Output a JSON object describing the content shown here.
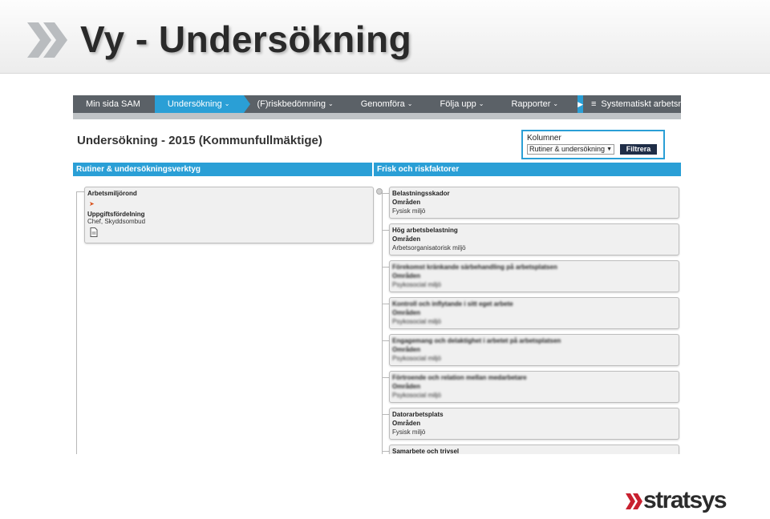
{
  "slide": {
    "title": "Vy - Undersökning",
    "logo_text": "stratsys"
  },
  "nav": {
    "items": [
      {
        "label": "Min sida SAM",
        "dropdown": false,
        "active": false
      },
      {
        "label": "Undersökning",
        "dropdown": true,
        "active": true
      },
      {
        "label": "(F)riskbedömning",
        "dropdown": true,
        "active": false
      },
      {
        "label": "Genomföra",
        "dropdown": true,
        "active": false
      },
      {
        "label": "Följa upp",
        "dropdown": true,
        "active": false
      },
      {
        "label": "Rapporter",
        "dropdown": true,
        "active": false
      }
    ],
    "last_label": "Systematiskt arbetsmiljöar..."
  },
  "page": {
    "title": "Undersökning - 2015 (Kommunfullmäktige)"
  },
  "columns_box": {
    "label": "Kolumner",
    "selected": "Rutiner & undersökning",
    "filter_button": "Filtrera"
  },
  "headers": {
    "left": "Rutiner & undersökningsverktyg",
    "right": "Frisk och riskfaktorer"
  },
  "left_card": {
    "title": "Arbetsmiljörond",
    "subtitle": "Uppgiftsfördelning",
    "roles": "Chef, Skyddsombud"
  },
  "right_cards": [
    {
      "title": "Belastningsskador",
      "area_label": "Områden",
      "area": "Fysisk miljö",
      "blurred": false
    },
    {
      "title": "Hög arbetsbelastning",
      "area_label": "Områden",
      "area": "Arbetsorganisatorisk miljö",
      "blurred": false
    },
    {
      "title": "Förekomst kränkande särbehandling på arbetsplatsen",
      "area_label": "Områden",
      "area": "Psykosocial miljö",
      "blurred": true
    },
    {
      "title": "Kontroll och inflytande i sitt eget arbete",
      "area_label": "Områden",
      "area": "Psykosocial miljö",
      "blurred": true
    },
    {
      "title": "Engagemang och delaktighet i arbetet på arbetsplatsen",
      "area_label": "Områden",
      "area": "Psykosocial miljö",
      "blurred": true
    },
    {
      "title": "Förtroende och relation mellan medarbetare",
      "area_label": "Områden",
      "area": "Psykosocial miljö",
      "blurred": true
    },
    {
      "title": "Datorarbetsplats",
      "area_label": "Områden",
      "area": "Fysisk miljö",
      "blurred": false
    },
    {
      "title": "Samarbete och trivsel",
      "area_label": "",
      "area": "",
      "blurred": false
    }
  ],
  "colors": {
    "nav_bg": "#5b6167",
    "accent": "#2a9fd6",
    "button_dark": "#1f2d47"
  }
}
